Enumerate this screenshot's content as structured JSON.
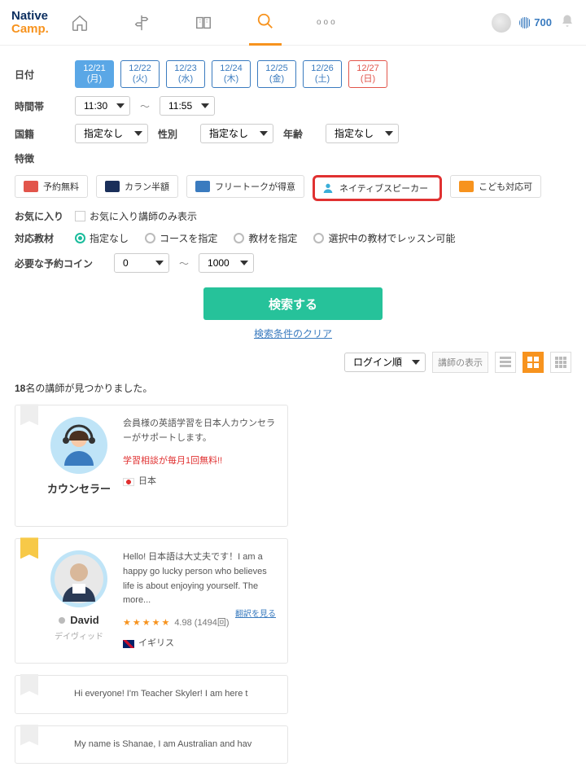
{
  "header": {
    "logo1": "Native",
    "logo2": "Camp.",
    "coins": "700"
  },
  "form": {
    "date_label": "日付",
    "dates": [
      {
        "md": "12/21",
        "dow": "(月)",
        "cls": "sel"
      },
      {
        "md": "12/22",
        "dow": "(火)",
        "cls": ""
      },
      {
        "md": "12/23",
        "dow": "(水)",
        "cls": ""
      },
      {
        "md": "12/24",
        "dow": "(木)",
        "cls": ""
      },
      {
        "md": "12/25",
        "dow": "(金)",
        "cls": ""
      },
      {
        "md": "12/26",
        "dow": "(土)",
        "cls": "sat"
      },
      {
        "md": "12/27",
        "dow": "(日)",
        "cls": "sun"
      }
    ],
    "time_label": "時間帯",
    "time_from": "11:30",
    "time_to": "11:55",
    "nation_label": "国籍",
    "nation_val": "指定なし",
    "gender_label": "性別",
    "gender_val": "指定なし",
    "age_label": "年齢",
    "age_val": "指定なし",
    "feature_label": "特徴",
    "features": [
      {
        "name": "予約無料",
        "color": "#e2554b"
      },
      {
        "name": "カラン半額",
        "color": "#1a2f5a"
      },
      {
        "name": "フリートークが得意",
        "color": "#3a7bbf"
      },
      {
        "name": "ネイティブスピーカー",
        "color": "#3aaed8",
        "hl": true
      },
      {
        "name": "こども対応可",
        "color": "#f7931e"
      }
    ],
    "fav_label": "お気に入り",
    "fav_opt": "お気に入り講師のみ表示",
    "mat_label": "対応教材",
    "mat_opts": [
      "指定なし",
      "コースを指定",
      "教材を指定",
      "選択中の教材でレッスン可能"
    ],
    "coin_label": "必要な予約コイン",
    "coin_from": "0",
    "coin_to": "1000",
    "search_btn": "検索する",
    "clear_link": "検索条件のクリア",
    "sort_val": "ログイン順",
    "disp_label": "講師の表示"
  },
  "results": {
    "count": "18",
    "suffix": "名の講師が見つかりました。"
  },
  "cards": [
    {
      "ribbon": "",
      "avatar": "counselor",
      "name": "カウンセラー",
      "sub": "",
      "body": "会員様の英語学習を日本人カウンセラーがサポートします。",
      "promo": "学習相談が毎月1回無料!!",
      "country": "日本",
      "flag": "jp"
    },
    {
      "ribbon": "gold",
      "avatar": "david",
      "name": "David",
      "sub": "デイヴィッド",
      "status": true,
      "body": "Hello! 日本語は大丈夫です！I am a happy go lucky person who believes life is about enjoying yourself. The more...",
      "more": "翻訳を見る",
      "rating": "4.98",
      "reviews": "(1494回)",
      "country": "イギリス",
      "flag": "uk"
    },
    {
      "ribbon": "",
      "partial": true,
      "body": "Hi everyone! I'm Teacher Skyler! I am here t"
    },
    {
      "ribbon": "",
      "partial": true,
      "body": "My name is Shanae, I am Australian and hav"
    }
  ]
}
